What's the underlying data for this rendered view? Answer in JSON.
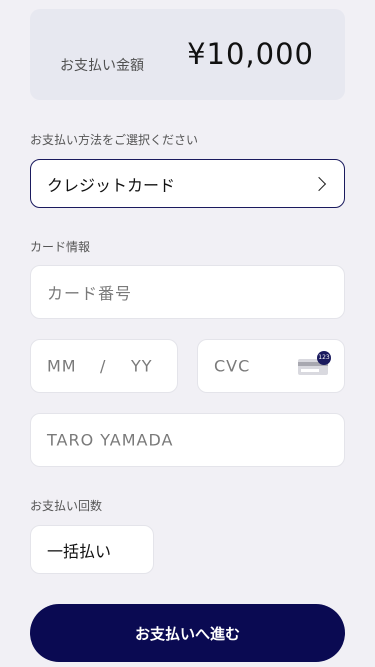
{
  "summary": {
    "amount_label": "お支払い金額",
    "amount_value": "¥10,000"
  },
  "payment_method": {
    "section_label": "お支払い方法をご選択ください",
    "selected": "クレジットカード",
    "icon": "chevron-right-icon"
  },
  "card_info": {
    "section_label": "カード情報",
    "card_number_placeholder": "カード番号",
    "expiry_month_placeholder": "MM",
    "expiry_separator": "/",
    "expiry_year_placeholder": "YY",
    "cvc_placeholder": "CVC",
    "cvc_icon_badge": "123",
    "name_placeholder": "TARO YAMADA"
  },
  "installments": {
    "section_label": "お支払い回数",
    "selected": "一括払い"
  },
  "submit": {
    "label": "お支払いへ進む"
  },
  "colors": {
    "background": "#f1f0f5",
    "summary_card": "#e7e8f0",
    "accent_navy": "#0a0a52"
  }
}
